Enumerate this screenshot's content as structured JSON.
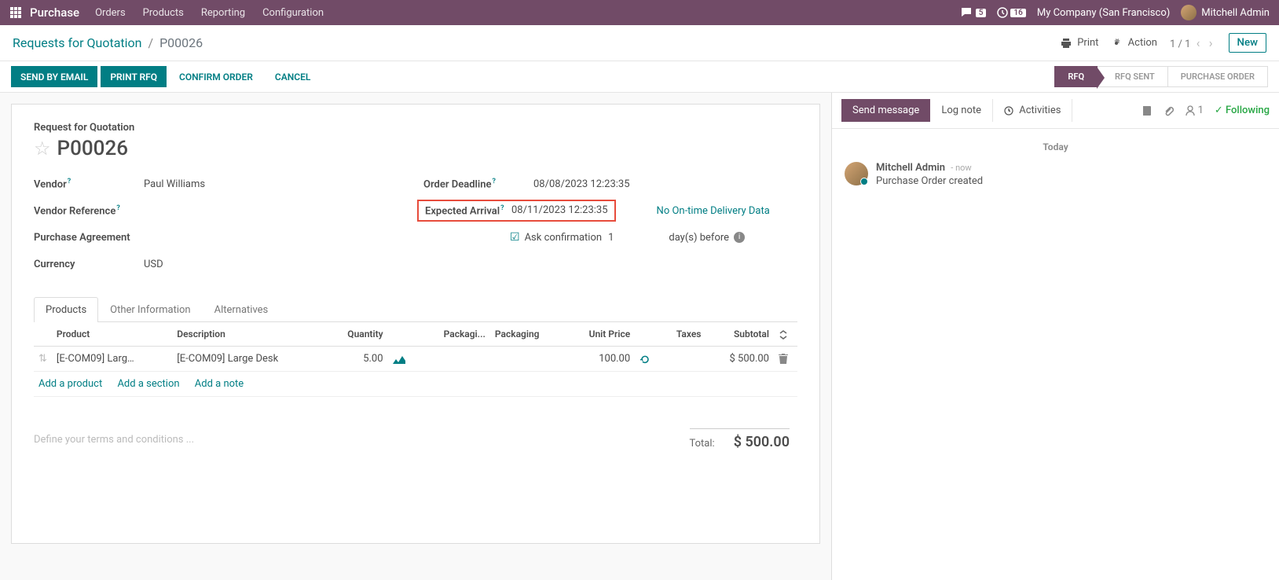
{
  "nav": {
    "brand": "Purchase",
    "menu": [
      "Orders",
      "Products",
      "Reporting",
      "Configuration"
    ],
    "chat_badge": "5",
    "clock_badge": "16",
    "company": "My Company (San Francisco)",
    "user": "Mitchell Admin"
  },
  "breadcrumb": {
    "root": "Requests for Quotation",
    "current": "P00026"
  },
  "controlbar": {
    "print": "Print",
    "action": "Action",
    "pager": "1 / 1",
    "new": "New"
  },
  "actions": {
    "send_email": "SEND BY EMAIL",
    "print_rfq": "PRINT RFQ",
    "confirm": "CONFIRM ORDER",
    "cancel": "CANCEL"
  },
  "status": {
    "rfq": "RFQ",
    "rfq_sent": "RFQ SENT",
    "po": "PURCHASE ORDER"
  },
  "doc": {
    "subtitle": "Request for Quotation",
    "name": "P00026"
  },
  "fields": {
    "vendor_lbl": "Vendor",
    "vendor": "Paul Williams",
    "vendor_ref_lbl": "Vendor Reference",
    "agreement_lbl": "Purchase Agreement",
    "currency_lbl": "Currency",
    "currency": "USD",
    "deadline_lbl": "Order Deadline",
    "deadline": "08/08/2023 12:23:35",
    "expected_lbl": "Expected Arrival",
    "expected": "08/11/2023 12:23:35",
    "delivery_data": "No On-time Delivery Data",
    "ask_conf": "Ask confirmation",
    "ask_conf_days": "1",
    "days_before": "day(s) before"
  },
  "tabs": {
    "products": "Products",
    "other": "Other Information",
    "alternatives": "Alternatives"
  },
  "table": {
    "headers": {
      "product": "Product",
      "description": "Description",
      "quantity": "Quantity",
      "packaging_qty": "Packagi...",
      "packaging": "Packaging",
      "unit_price": "Unit Price",
      "taxes": "Taxes",
      "subtotal": "Subtotal"
    },
    "row": {
      "product": "[E-COM09] Larg…",
      "description": "[E-COM09] Large Desk",
      "quantity": "5.00",
      "unit_price": "100.00",
      "subtotal": "$ 500.00"
    },
    "add_product": "Add a product",
    "add_section": "Add a section",
    "add_note": "Add a note"
  },
  "terms_placeholder": "Define your terms and conditions ...",
  "totals": {
    "label": "Total:",
    "value": "$ 500.00"
  },
  "chatter": {
    "send": "Send message",
    "log": "Log note",
    "activities": "Activities",
    "follower_count": "1",
    "following": "Following",
    "today": "Today",
    "msg_author": "Mitchell Admin",
    "msg_time": "now",
    "msg_body": "Purchase Order created"
  }
}
